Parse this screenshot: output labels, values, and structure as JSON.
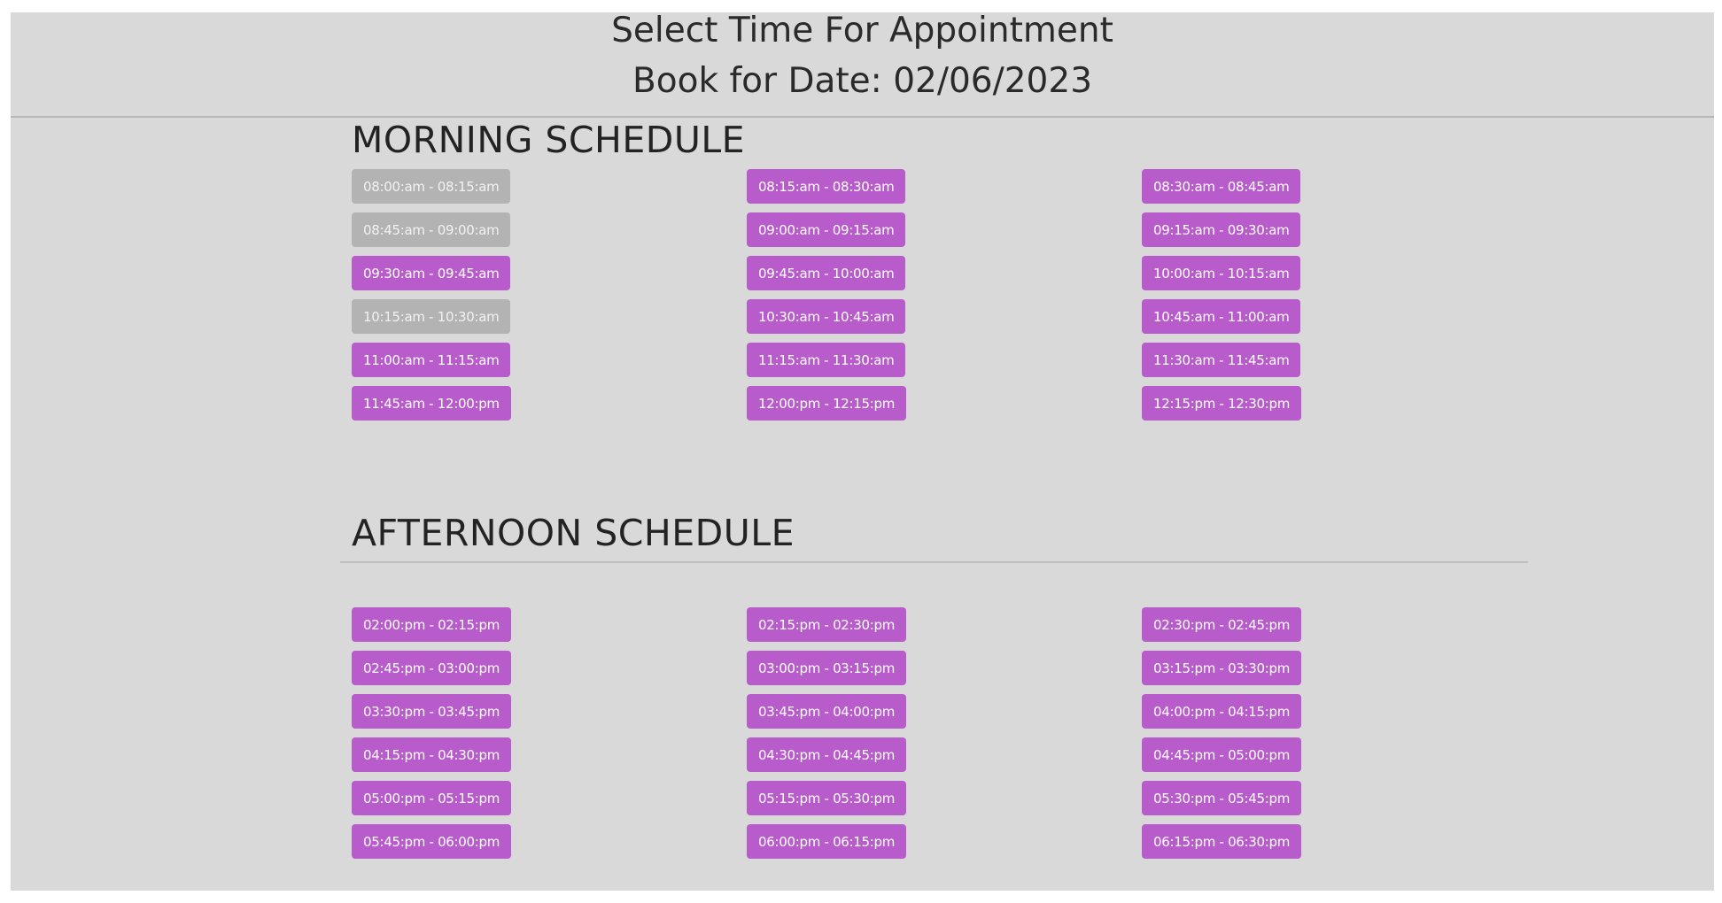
{
  "header": {
    "title": "Select Time For Appointment",
    "date_line": "Book for Date: 02/06/2023"
  },
  "colors": {
    "available": "#b85ccb",
    "booked": "#b3b3b3",
    "background": "#d9d9d9"
  },
  "morning": {
    "title": "MORNING SCHEDULE",
    "slots": [
      {
        "label": "08:00:am - 08:15:am",
        "status": "booked"
      },
      {
        "label": "08:15:am - 08:30:am",
        "status": "available"
      },
      {
        "label": "08:30:am - 08:45:am",
        "status": "available"
      },
      {
        "label": "08:45:am - 09:00:am",
        "status": "booked"
      },
      {
        "label": "09:00:am - 09:15:am",
        "status": "available"
      },
      {
        "label": "09:15:am - 09:30:am",
        "status": "available"
      },
      {
        "label": "09:30:am - 09:45:am",
        "status": "available"
      },
      {
        "label": "09:45:am - 10:00:am",
        "status": "available"
      },
      {
        "label": "10:00:am - 10:15:am",
        "status": "available"
      },
      {
        "label": "10:15:am - 10:30:am",
        "status": "booked"
      },
      {
        "label": "10:30:am - 10:45:am",
        "status": "available"
      },
      {
        "label": "10:45:am - 11:00:am",
        "status": "available"
      },
      {
        "label": "11:00:am - 11:15:am",
        "status": "available"
      },
      {
        "label": "11:15:am - 11:30:am",
        "status": "available"
      },
      {
        "label": "11:30:am - 11:45:am",
        "status": "available"
      },
      {
        "label": "11:45:am - 12:00:pm",
        "status": "available"
      },
      {
        "label": "12:00:pm - 12:15:pm",
        "status": "available"
      },
      {
        "label": "12:15:pm - 12:30:pm",
        "status": "available"
      }
    ]
  },
  "afternoon": {
    "title": "AFTERNOON SCHEDULE",
    "slots": [
      {
        "label": "02:00:pm - 02:15:pm",
        "status": "available"
      },
      {
        "label": "02:15:pm - 02:30:pm",
        "status": "available"
      },
      {
        "label": "02:30:pm - 02:45:pm",
        "status": "available"
      },
      {
        "label": "02:45:pm - 03:00:pm",
        "status": "available"
      },
      {
        "label": "03:00:pm - 03:15:pm",
        "status": "available"
      },
      {
        "label": "03:15:pm - 03:30:pm",
        "status": "available"
      },
      {
        "label": "03:30:pm - 03:45:pm",
        "status": "available"
      },
      {
        "label": "03:45:pm - 04:00:pm",
        "status": "available"
      },
      {
        "label": "04:00:pm - 04:15:pm",
        "status": "available"
      },
      {
        "label": "04:15:pm - 04:30:pm",
        "status": "available"
      },
      {
        "label": "04:30:pm - 04:45:pm",
        "status": "available"
      },
      {
        "label": "04:45:pm - 05:00:pm",
        "status": "available"
      },
      {
        "label": "05:00:pm - 05:15:pm",
        "status": "available"
      },
      {
        "label": "05:15:pm - 05:30:pm",
        "status": "available"
      },
      {
        "label": "05:30:pm - 05:45:pm",
        "status": "available"
      },
      {
        "label": "05:45:pm - 06:00:pm",
        "status": "available"
      },
      {
        "label": "06:00:pm - 06:15:pm",
        "status": "available"
      },
      {
        "label": "06:15:pm - 06:30:pm",
        "status": "available"
      }
    ]
  }
}
